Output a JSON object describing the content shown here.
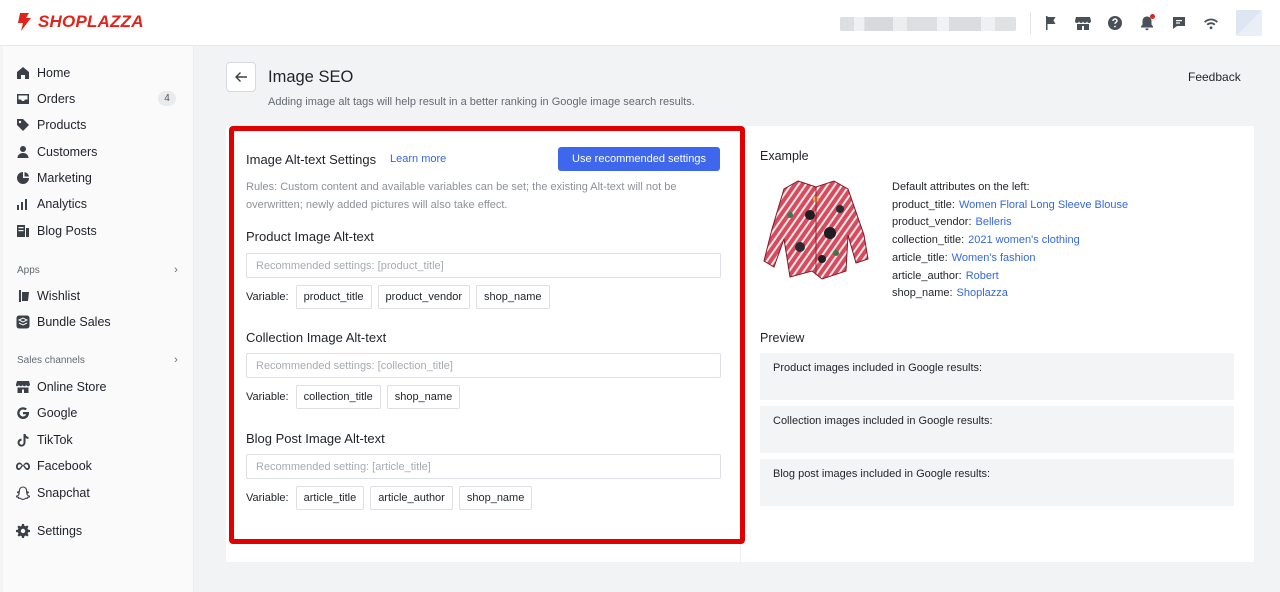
{
  "brand": {
    "name": "SHOPLAZZA",
    "color": "#e2231a"
  },
  "topbar": {
    "icons": [
      "flag-icon",
      "store-icon",
      "help-icon",
      "bell-icon",
      "chat-icon",
      "wifi-icon"
    ],
    "notification_dot_color": "#e2231a"
  },
  "sidebar": {
    "main_items": [
      {
        "label": "Home",
        "icon": "home-icon"
      },
      {
        "label": "Orders",
        "icon": "orders-icon",
        "badge": "4"
      },
      {
        "label": "Products",
        "icon": "tag-icon"
      },
      {
        "label": "Customers",
        "icon": "person-icon"
      },
      {
        "label": "Marketing",
        "icon": "marketing-icon"
      },
      {
        "label": "Analytics",
        "icon": "bar-chart-icon"
      },
      {
        "label": "Blog Posts",
        "icon": "blog-icon"
      }
    ],
    "apps_heading": "Apps",
    "apps_items": [
      {
        "label": "Wishlist",
        "icon": "wishlist-icon"
      },
      {
        "label": "Bundle Sales",
        "icon": "bundle-icon"
      }
    ],
    "channels_heading": "Sales channels",
    "channels_items": [
      {
        "label": "Online Store",
        "icon": "store-icon"
      },
      {
        "label": "Google",
        "icon": "google-icon"
      },
      {
        "label": "TikTok",
        "icon": "tiktok-icon"
      },
      {
        "label": "Facebook",
        "icon": "meta-icon"
      },
      {
        "label": "Snapchat",
        "icon": "snapchat-icon"
      }
    ],
    "settings": {
      "label": "Settings",
      "icon": "gear-icon"
    }
  },
  "header": {
    "title": "Image SEO",
    "subtitle": "Adding image alt tags will help result in a better ranking in Google image search results.",
    "feedback": "Feedback"
  },
  "settings_panel": {
    "title": "Image Alt-text Settings",
    "learn_more": "Learn more",
    "primary_button": "Use recommended settings",
    "rules": "Rules: Custom content and available variables can be set; the existing Alt-text will not be overwritten; newly added pictures will also take effect.",
    "variable_label": "Variable:",
    "sections": [
      {
        "title": "Product Image Alt-text",
        "placeholder": "Recommended settings: [product_title]",
        "variables": [
          "product_title",
          "product_vendor",
          "shop_name"
        ]
      },
      {
        "title": "Collection Image Alt-text",
        "placeholder": "Recommended settings: [collection_title]",
        "variables": [
          "collection_title",
          "shop_name"
        ]
      },
      {
        "title": "Blog Post Image Alt-text",
        "placeholder": "Recommended setting: [article_title]",
        "variables": [
          "article_title",
          "article_author",
          "shop_name"
        ]
      }
    ]
  },
  "example": {
    "title": "Example",
    "attributes_heading": "Default attributes on the left:",
    "attributes": [
      {
        "key": "product_title:",
        "value": "Women Floral Long Sleeve Blouse"
      },
      {
        "key": "product_vendor:",
        "value": "Belleris"
      },
      {
        "key": "collection_title:",
        "value": "2021 women's clothing"
      },
      {
        "key": "article_title:",
        "value": "Women's fashion"
      },
      {
        "key": "article_author:",
        "value": "Robert"
      },
      {
        "key": "shop_name:",
        "value": "Shoplazza"
      }
    ]
  },
  "preview": {
    "title": "Preview",
    "rows": [
      "Product images included in Google results:",
      "Collection images included in Google results:",
      "Blog post images included in Google results:"
    ]
  },
  "colors": {
    "accent": "#3f67ed",
    "link": "#3669d6",
    "highlight_border": "#e00000"
  }
}
